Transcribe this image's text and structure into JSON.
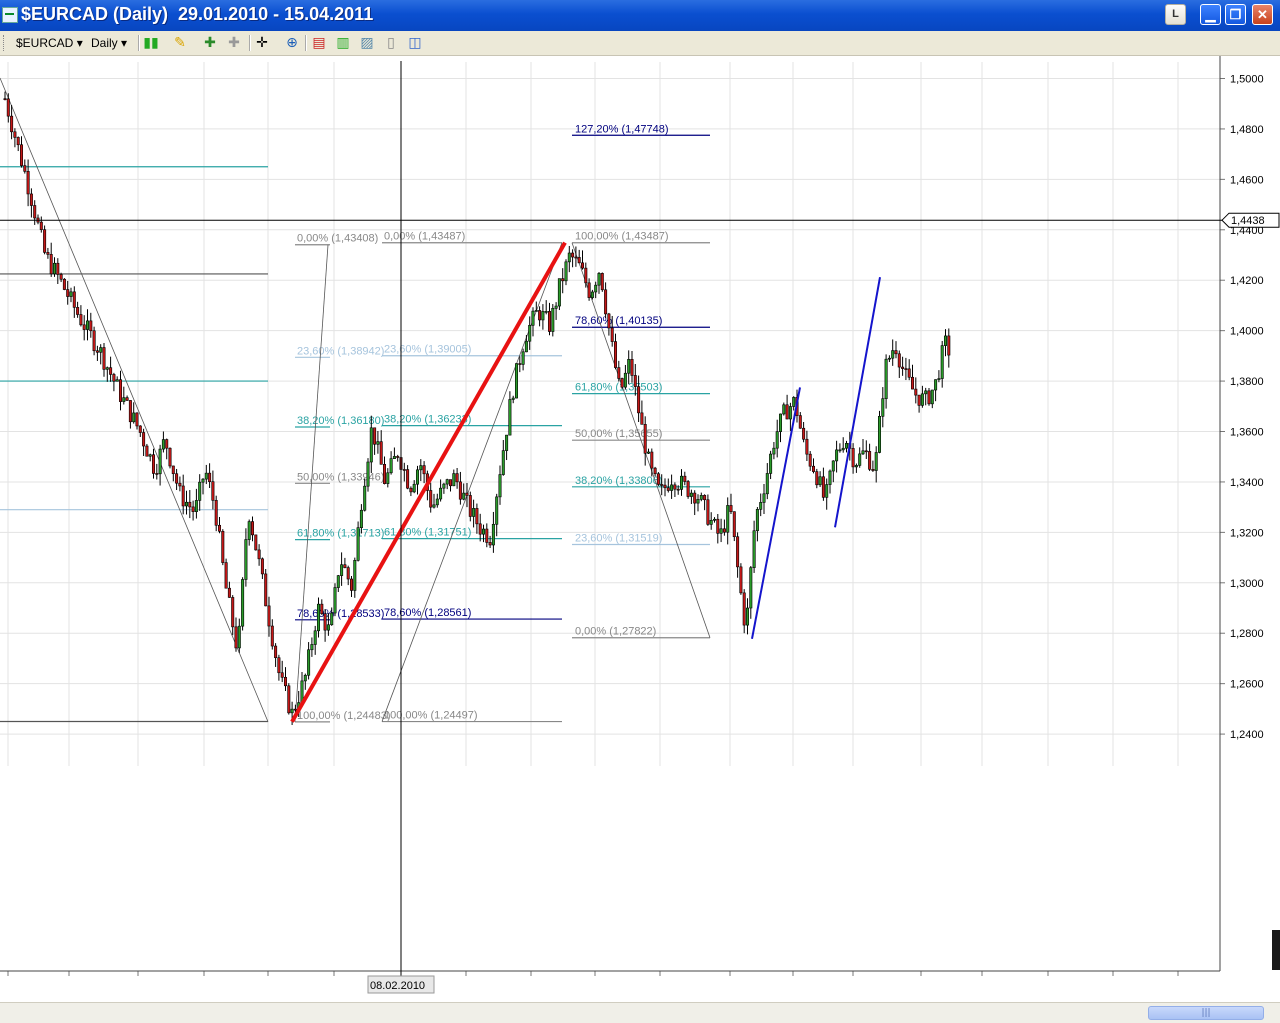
{
  "window": {
    "title": "$EURCAD (Daily)  29.01.2010 - 15.04.2011",
    "buttons": [
      "L",
      "▁",
      "❐",
      "✕"
    ]
  },
  "toolbar": {
    "symbol": "$EURCAD",
    "timeframe": "Daily",
    "icons": [
      "candlestick-icon",
      "pencil-icon",
      "add-indicator-icon",
      "remove-indicator-icon",
      "crosshair-icon",
      "zoom-icon",
      "bars-icon",
      "chart-icon",
      "area-chart-icon",
      "template-icon",
      "layout-icon"
    ]
  },
  "colors": {
    "title_bar": "#0a4fd0",
    "fib_level_grey": "#888888",
    "fib_level_blue": "#00007f",
    "fib_level_teal": "#2aa3a3",
    "fib_level_light": "#a6c4dd",
    "trend_red": "#e81212",
    "trend_blue": "#1414cc"
  },
  "chart": {
    "crosshair_value": "1,4438",
    "crosshair_date": "08.02.2010",
    "y_ticks": [
      "1,5000",
      "1,4800",
      "1,4600",
      "1,4400",
      "1,4200",
      "1,4000",
      "1,3800",
      "1,3600",
      "1,3400",
      "1,3200",
      "1,3000",
      "1,2800",
      "1,2600",
      "1,2400"
    ],
    "fib_labels": [
      {
        "text": "0,00% (1,43408)",
        "color": "#888888"
      },
      {
        "text": "23,60% (1,38942)",
        "color": "#a6c4dd"
      },
      {
        "text": "38,20% (1,36180)",
        "color": "#2aa3a3"
      },
      {
        "text": "50,00% (1,33946)",
        "color": "#888888"
      },
      {
        "text": "61,80% (1,31713)",
        "color": "#2aa3a3"
      },
      {
        "text": "78,60% (1,28533)",
        "color": "#00007f"
      },
      {
        "text": "100,00% (1,24483)",
        "color": "#888888"
      },
      {
        "text": "0,00% (1,43487)",
        "color": "#888888"
      },
      {
        "text": "23,60% (1,39005)",
        "color": "#a6c4dd"
      },
      {
        "text": "38,20% (1,36233)",
        "color": "#2aa3a3"
      },
      {
        "text": "61,80% (1,31751)",
        "color": "#2aa3a3"
      },
      {
        "text": "78,60% (1,28561)",
        "color": "#00007f"
      },
      {
        "text": "100,00% (1,24497)",
        "color": "#888888"
      },
      {
        "text": "127,20% (1,47748)",
        "color": "#00007f"
      },
      {
        "text": "100,00% (1,43487)",
        "color": "#888888"
      },
      {
        "text": "78,60% (1,40135)",
        "color": "#00007f"
      },
      {
        "text": "61,80% (1,37503)",
        "color": "#2aa3a3"
      },
      {
        "text": "50,00% (1,35655)",
        "color": "#888888"
      },
      {
        "text": "38,20% (1,33806)",
        "color": "#2aa3a3"
      },
      {
        "text": "23,60% (1,31519)",
        "color": "#a6c4dd"
      },
      {
        "text": "0,00% (1,27822)",
        "color": "#888888"
      }
    ]
  }
}
